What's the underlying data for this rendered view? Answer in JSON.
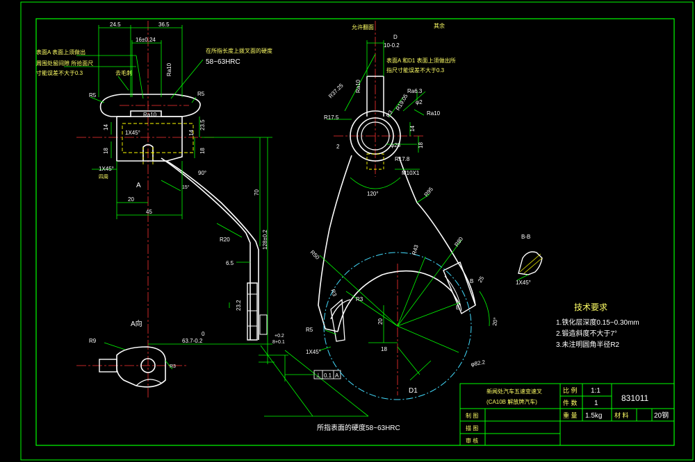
{
  "colors": {
    "background": "#000000",
    "frame": "#00ff00",
    "outline": "#ffffff",
    "dimension": "#00ff00",
    "center_line": "#ff3333",
    "hidden_line": "#ffff00",
    "arc_sweep": "#44ddff",
    "text": "#ffffff"
  },
  "left_view": {
    "dims": {
      "d_24_5": "24.5",
      "d_36_5": "36.5",
      "d_16": "16±0.24",
      "d_14a": "14",
      "d_18a": "18",
      "d_23_5": "23.5",
      "d_14b": "14",
      "d_18b": "18",
      "d_20": "20",
      "d_45": "45",
      "d_70": "70",
      "d_128": "128±0.2",
      "d_6_5": "6.5",
      "d_63_7": "63.7-0.2",
      "d_tol_top": "+0.2",
      "d_tol_bot": "8+0.1",
      "d_23_2": "23.2",
      "d_r5_a": "R5",
      "d_r5_b": "R5",
      "d_r20": "R20",
      "d_r9": "R9",
      "d_90": "90°",
      "d_15": "15°",
      "chamfer": "1X45°",
      "chamfer_b": "1X45°",
      "chamfer_b_note": "四周",
      "ra": "Ra10",
      "ra2": "Ra10",
      "view_a": "A",
      "view_a_label": "A向",
      "zero": "0",
      "small_r": "R3"
    },
    "notes": {
      "note_a_line1": "表面A 表面上须做出",
      "note_a_line2": "周围处留间隙 所拾面尺",
      "note_a_line3": "寸能误差不大于0.3",
      "note_both": "在所指长度上拨叉面的硬度",
      "hrc_top": "58~63HRC",
      "both_sides": "去毛刺",
      "bottom_hrc": "所指表面的硬度58~63HRC"
    },
    "tolerance_frame": [
      "⊥",
      "0.1",
      "A"
    ]
  },
  "right_view": {
    "dims": {
      "d_10": "10-0.2",
      "d_d": "D",
      "d_r37": "R37.25",
      "d_r17_5": "R17.5",
      "d_r17_8": "R17.8",
      "d_r19": "R19.05",
      "d_r3": "R3",
      "d_phi2": "φ2",
      "d_14": "14",
      "d_18": "18",
      "d_phi28": "φ28",
      "d_m10": "M10X1",
      "d_120": "120°",
      "d_r95": "R95",
      "d_r50": "R50",
      "d_r43": "R43",
      "d_r80": "R80",
      "d_r3b": "R3",
      "d_r5": "R5",
      "d_r3c": "R3",
      "d_20": "20",
      "d_18b": "18",
      "d_b": "B",
      "d_b2": "B",
      "d_20deg": "20°",
      "d_25": "25",
      "d_phi82": "φ82.2",
      "d_d1": "D1",
      "chamfer": "1X45°",
      "ra": "Ra10",
      "ra2": "Ra6.3",
      "ra3": "Ra10",
      "two": "2"
    },
    "notes": {
      "top_label": "允许翻面",
      "note_line1": "表面A 和D1 表面上须做出所",
      "note_line2": "指尺寸能误差不大于0.3",
      "rest": "其余"
    }
  },
  "section_bb": {
    "label": "B-B",
    "chamfer": "1X45°"
  },
  "tech_requirements": {
    "title": "技术要求",
    "items": [
      "1.铁化层深度0.15~0.30mm",
      "2.锻造斜度不大于7°",
      "3.未注明圆角半径R2"
    ]
  },
  "title_block": {
    "part_name": "新闻处汽车五速变速叉",
    "part_model": "(CA10B 解放牌汽车)",
    "scale_label": "比 例",
    "scale_value": "1:1",
    "qty_label": "件 数",
    "qty_value": "1",
    "drawing_no": "831011",
    "weight_label": "重 量",
    "weight_value": "1.5kg",
    "material_label": "材 料",
    "material_value": "20钢",
    "drawn_label": "制 图",
    "drafted_label": "描 图",
    "checked_label": "审 核"
  }
}
